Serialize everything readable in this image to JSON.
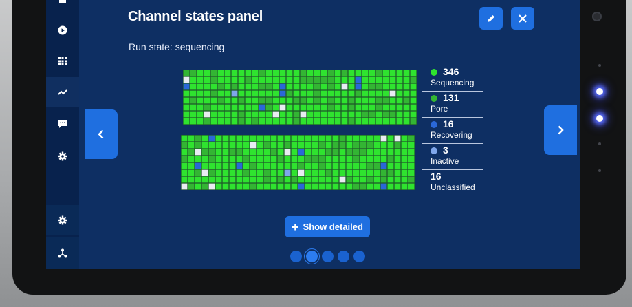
{
  "panel": {
    "title": "Channel states panel",
    "run_state": "Run state: sequencing",
    "show_detailed_label": "Show detailed",
    "pager": {
      "pages": 5,
      "current": 1
    }
  },
  "colors": {
    "sequencing": "#2fe32f",
    "pore": "#33b533",
    "recovering": "#2a68d8",
    "inactive": "#7fa6ea",
    "unclassified": "#e8ecf2",
    "accent": "#1f6fe0",
    "background": "#0e2f63"
  },
  "legend": [
    {
      "count": "346",
      "label": "Sequencing",
      "color": "#2fe32f"
    },
    {
      "count": "131",
      "label": "Pore",
      "color": "#33b533"
    },
    {
      "count": "16",
      "label": "Recovering",
      "color": "#2a68d8"
    },
    {
      "count": "3",
      "label": "Inactive",
      "color": "#7fa6ea"
    },
    {
      "count": "16",
      "label": "Unclassified",
      "color": null
    }
  ],
  "sidebar": {
    "icons": [
      "stop-icon",
      "play-icon",
      "grid-icon",
      "activity-chart-icon",
      "message-icon",
      "gear-icon",
      "gear-icon",
      "network-icon"
    ]
  },
  "header": {
    "icons": [
      "pen-icon",
      "close-icon"
    ]
  }
}
